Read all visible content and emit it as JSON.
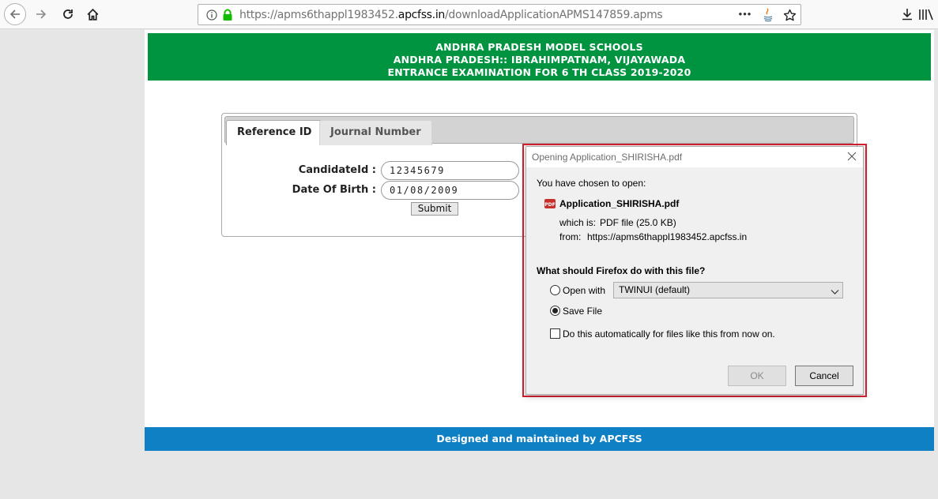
{
  "browser": {
    "url_prefix": "https://apms6thappl1983452.",
    "url_domain": "apcfss.in",
    "url_path": "/downloadApplicationAPMS147859.apms",
    "page_actions": "•••"
  },
  "header": {
    "line1": "ANDHRA PRADESH MODEL SCHOOLS",
    "line2": "ANDHRA PRADESH:: IBRAHIMPATNAM, VIJAYAWADA",
    "line3": "ENTRANCE EXAMINATION FOR 6 TH CLASS 2019-2020"
  },
  "tabs": {
    "reference": "Reference ID",
    "journal": "Journal Number"
  },
  "form": {
    "candidate_label": "CandidateId :",
    "candidate_value": "12345679",
    "dob_label": "Date Of Birth :",
    "dob_value": "01/08/2009",
    "submit": "Submit"
  },
  "footer": {
    "text": "Designed and maintained by APCFSS"
  },
  "dialog": {
    "title": "Opening Application_SHIRISHA.pdf",
    "chosen": "You have chosen to open:",
    "filename": "Application_SHIRISHA.pdf",
    "which_is_label": "which is:",
    "which_is_value": "PDF file (25.0 KB)",
    "from_label": "from:",
    "from_value": "https://apms6thappl1983452.apcfss.in",
    "question": "What should Firefox do with this file?",
    "open_with": "Open with",
    "open_with_app": "TWINUI (default)",
    "save_file": "Save File",
    "auto": "Do this automatically for files like this from now on.",
    "ok": "OK",
    "cancel": "Cancel"
  },
  "colors": {
    "header_green": "#009440",
    "footer_blue": "#0f80c4",
    "highlight_red": "#d8202f"
  }
}
